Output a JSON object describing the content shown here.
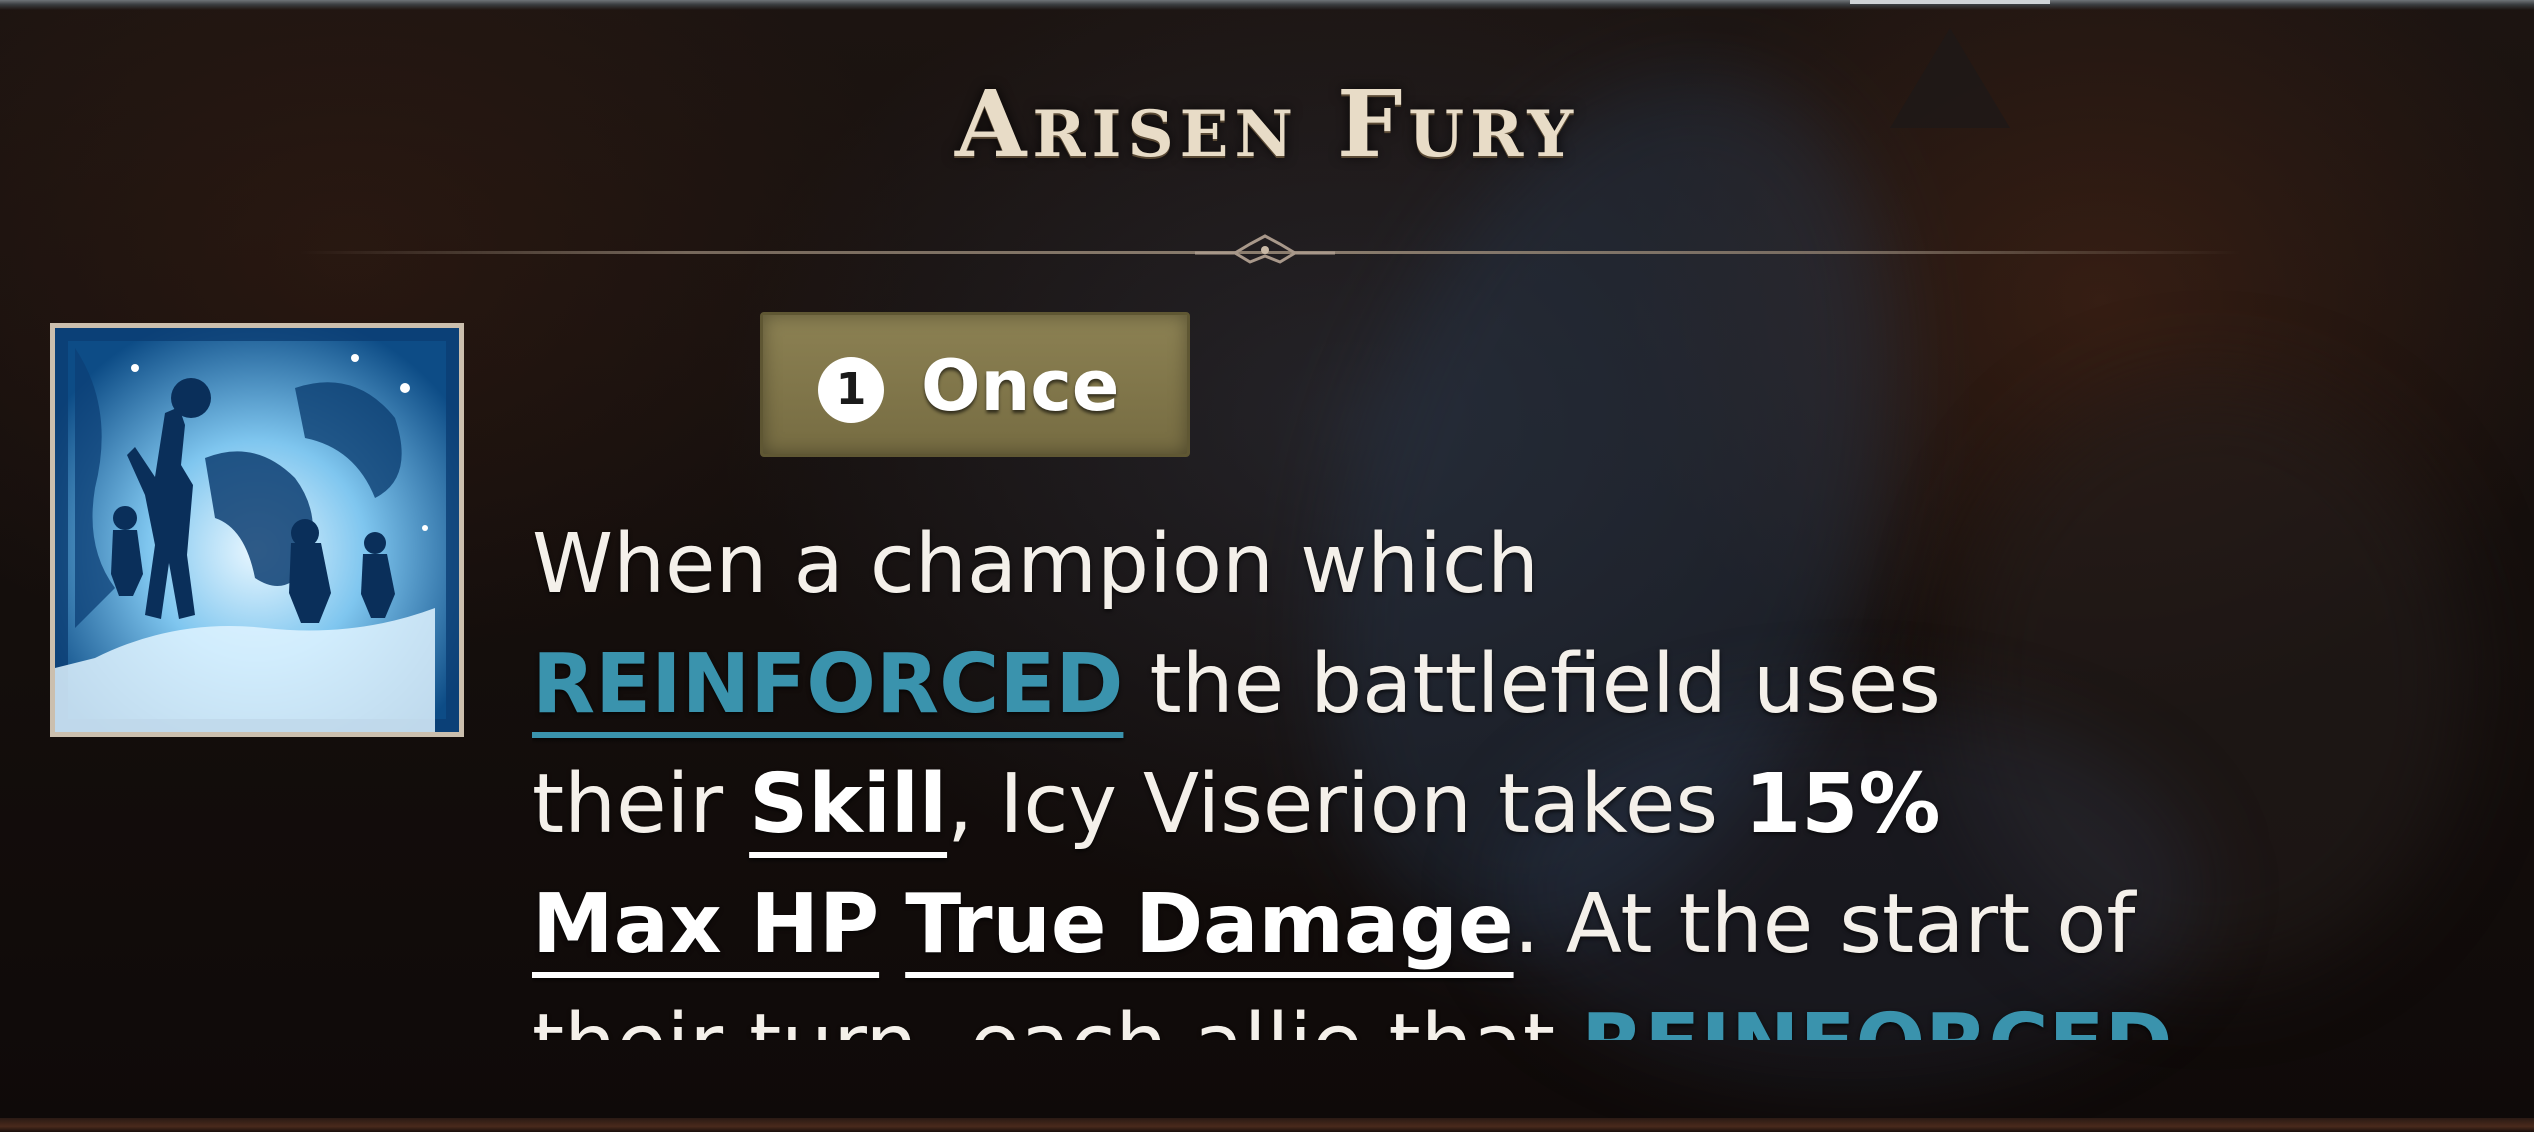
{
  "ability": {
    "title": "Arisen Fury",
    "icon": "frost-figures-skill-icon"
  },
  "frequency_badge": {
    "number": "1",
    "label": "Once"
  },
  "description": {
    "l1_t1": "When a champion which",
    "l2_kw1": "REINFORCED",
    "l2_t1": " the battlefield uses",
    "l3_t1": "their ",
    "l3_kw1": "Skill",
    "l3_t2": ", Icy Viserion takes ",
    "l3_b1": "15%",
    "l4_kw1": "Max HP",
    "l4_t1": " ",
    "l4_kw2": "True Damage",
    "l4_t2": ". At the start of",
    "l5_t1": "their turn, each allie that ",
    "l5_kw1": "REINFORCED"
  },
  "colors": {
    "keyword_blue": "#3a93ad",
    "badge_olive": "#8c8153",
    "title_cream": "#e8dcc7"
  }
}
